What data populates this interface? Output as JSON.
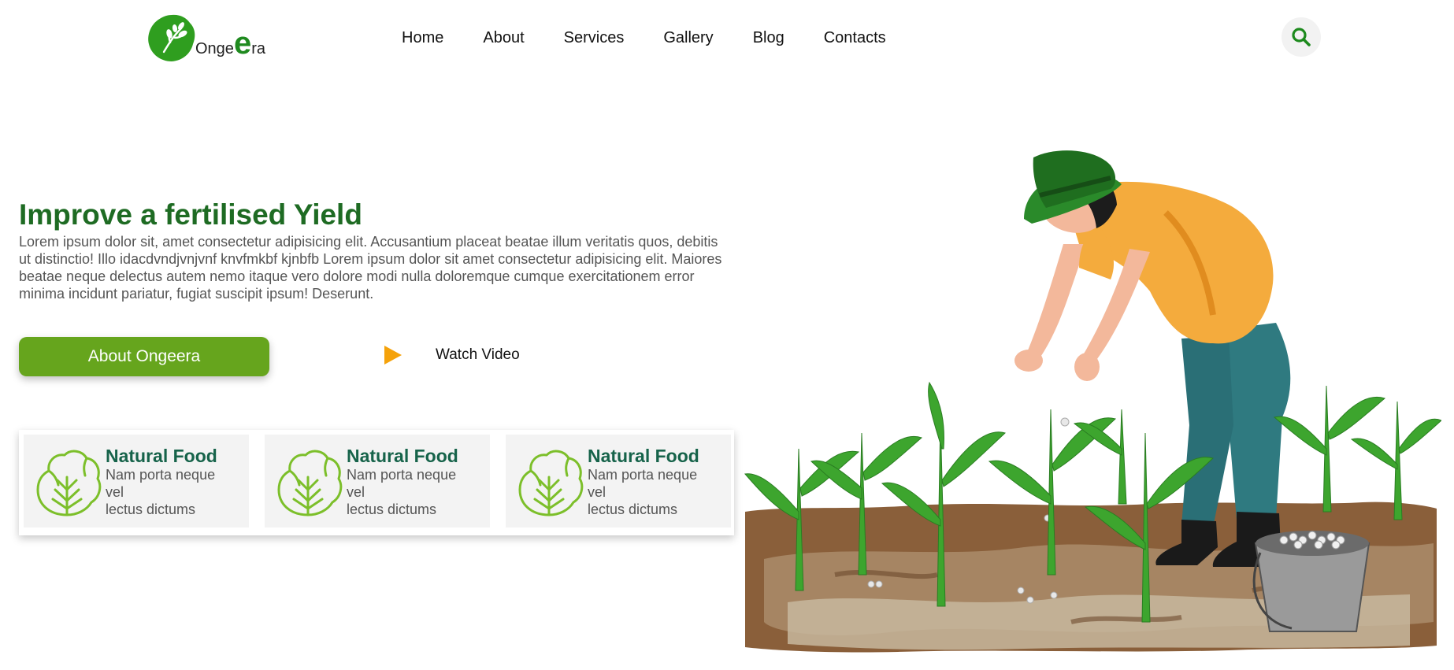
{
  "brand": {
    "logo_prefix": "Onge",
    "logo_big": "e",
    "logo_suffix": "ra"
  },
  "nav": {
    "items": [
      "Home",
      "About",
      "Services",
      "Gallery",
      "Blog",
      "Contacts"
    ]
  },
  "search": {
    "icon": "search-icon"
  },
  "hero": {
    "title": "Improve a fertilised Yield",
    "text": "Lorem ipsum dolor sit, amet consectetur adipisicing elit. Accusantium placeat beatae illum veritatis quos, debitis ut distinctio! Illo idacdvndjvnjvnf knvfmkbf kjnbfb Lorem ipsum dolor sit amet consectetur adipisicing elit. Maiores beatae neque delectus autem nemo itaque vero dolore modi nulla doloremque cumque exercitationem error minima incidunt pariatur, fugiat suscipit ipsum! Deserunt.",
    "primary_button": "About Ongeera",
    "video_label": "Watch Video"
  },
  "features": [
    {
      "title": "Natural Food",
      "line1": "Nam porta neque vel",
      "line2": "lectus dictums"
    },
    {
      "title": "Natural Food",
      "line1": "Nam porta neque vel",
      "line2": "lectus dictums"
    },
    {
      "title": "Natural Food",
      "line1": "Nam porta neque vel",
      "line2": "lectus dictums"
    }
  ],
  "colors": {
    "brand_green": "#1e6b23",
    "button_green": "#66a51d",
    "play_orange": "#f5a20a",
    "card_title": "#16634a"
  }
}
